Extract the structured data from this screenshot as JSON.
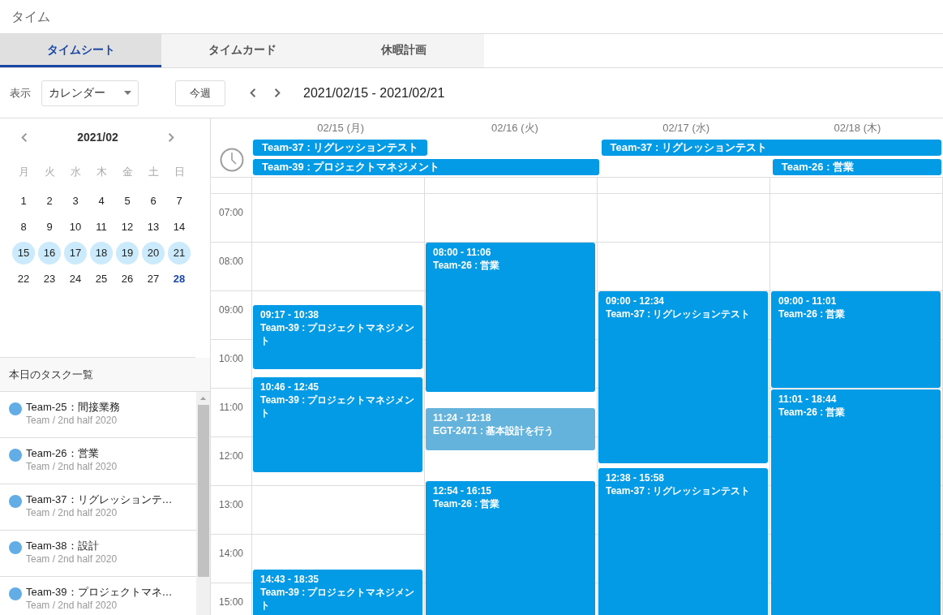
{
  "page_title": "タイム",
  "tabs": [
    {
      "label": "タイムシート",
      "selected": true
    },
    {
      "label": "タイムカード",
      "selected": false
    },
    {
      "label": "休暇計画",
      "selected": false
    }
  ],
  "toolbar": {
    "view_label": "表示",
    "view_select": "カレンダー",
    "today_button": "今週",
    "range": "2021/02/15 - 2021/02/21"
  },
  "mini_calendar": {
    "month": "2021/02",
    "weekdays": [
      "月",
      "火",
      "水",
      "木",
      "金",
      "土",
      "日"
    ],
    "days": [
      {
        "label": "1",
        "selected": false,
        "today": false
      },
      {
        "label": "2",
        "selected": false,
        "today": false
      },
      {
        "label": "3",
        "selected": false,
        "today": false
      },
      {
        "label": "4",
        "selected": false,
        "today": false
      },
      {
        "label": "5",
        "selected": false,
        "today": false
      },
      {
        "label": "6",
        "selected": false,
        "today": false
      },
      {
        "label": "7",
        "selected": false,
        "today": false
      },
      {
        "label": "8",
        "selected": false,
        "today": false
      },
      {
        "label": "9",
        "selected": false,
        "today": false
      },
      {
        "label": "10",
        "selected": false,
        "today": false
      },
      {
        "label": "11",
        "selected": false,
        "today": false
      },
      {
        "label": "12",
        "selected": false,
        "today": false
      },
      {
        "label": "13",
        "selected": false,
        "today": false
      },
      {
        "label": "14",
        "selected": false,
        "today": false
      },
      {
        "label": "15",
        "selected": true,
        "today": false
      },
      {
        "label": "16",
        "selected": true,
        "today": false
      },
      {
        "label": "17",
        "selected": true,
        "today": false
      },
      {
        "label": "18",
        "selected": true,
        "today": false
      },
      {
        "label": "19",
        "selected": true,
        "today": false
      },
      {
        "label": "20",
        "selected": true,
        "today": false
      },
      {
        "label": "21",
        "selected": true,
        "today": false
      },
      {
        "label": "22",
        "selected": false,
        "today": false
      },
      {
        "label": "23",
        "selected": false,
        "today": false
      },
      {
        "label": "24",
        "selected": false,
        "today": false
      },
      {
        "label": "25",
        "selected": false,
        "today": false
      },
      {
        "label": "26",
        "selected": false,
        "today": false
      },
      {
        "label": "27",
        "selected": false,
        "today": false
      },
      {
        "label": "28",
        "selected": false,
        "today": true
      }
    ]
  },
  "task_list": {
    "title": "本日のタスク一覧",
    "items": [
      {
        "title": "Team-25：間接業務",
        "subtitle": "Team / 2nd half 2020"
      },
      {
        "title": "Team-26：営業",
        "subtitle": "Team / 2nd half 2020"
      },
      {
        "title": "Team-37：リグレッションテ…",
        "subtitle": "Team / 2nd half 2020"
      },
      {
        "title": "Team-38：設計",
        "subtitle": "Team / 2nd half 2020"
      },
      {
        "title": "Team-39：プロジェクトマネ…",
        "subtitle": "Team / 2nd half 2020"
      }
    ]
  },
  "week": {
    "hours": [
      "07:00",
      "08:00",
      "09:00",
      "10:00",
      "11:00",
      "12:00",
      "13:00",
      "14:00",
      "15:00"
    ],
    "allday_rows": [
      [
        {
          "kind": "start",
          "label": "Team-37 : リグレッションテスト"
        },
        {
          "kind": "empty"
        },
        {
          "kind": "start",
          "label": "Team-37 : リグレッションテスト"
        },
        {
          "kind": "continue"
        }
      ],
      [
        {
          "kind": "start",
          "label": "Team-39 : プロジェクトマネジメント"
        },
        {
          "kind": "continue"
        },
        {
          "kind": "empty"
        },
        {
          "kind": "start",
          "label": "Team-26 : 営業"
        }
      ]
    ],
    "days": [
      {
        "label": "02/15 (月)",
        "events": [
          {
            "time": "09:17 - 10:38",
            "title": "Team-39 : プロジェクトマネジメント",
            "color": "#039be5"
          },
          {
            "time": "10:46 - 12:45",
            "title": "Team-39 : プロジェクトマネジメント",
            "color": "#039be5"
          },
          {
            "time": "14:43 - 18:35",
            "title": "Team-39 : プロジェクトマネジメント",
            "color": "#039be5"
          }
        ]
      },
      {
        "label": "02/16 (火)",
        "events": [
          {
            "time": "08:00 - 11:06",
            "title": "Team-26 : 営業",
            "color": "#039be5"
          },
          {
            "time": "11:24 - 12:18",
            "title": "EGT-2471 : 基本設計を行う",
            "color": "#64b3dc"
          },
          {
            "time": "12:54 - 16:15",
            "title": "Team-26 : 営業",
            "color": "#039be5"
          }
        ]
      },
      {
        "label": "02/17 (水)",
        "events": [
          {
            "time": "09:00 - 12:34",
            "title": "Team-37 : リグレッションテスト",
            "color": "#039be5"
          },
          {
            "time": "12:38 - 15:58",
            "title": "Team-37 : リグレッションテスト",
            "color": "#039be5"
          }
        ]
      },
      {
        "label": "02/18 (木)",
        "events": [
          {
            "time": "09:00 - 11:01",
            "title": "Team-26 : 営業",
            "color": "#039be5"
          },
          {
            "time": "11:01 - 18:44",
            "title": "Team-26 : 営業",
            "color": "#039be5"
          }
        ]
      }
    ]
  }
}
